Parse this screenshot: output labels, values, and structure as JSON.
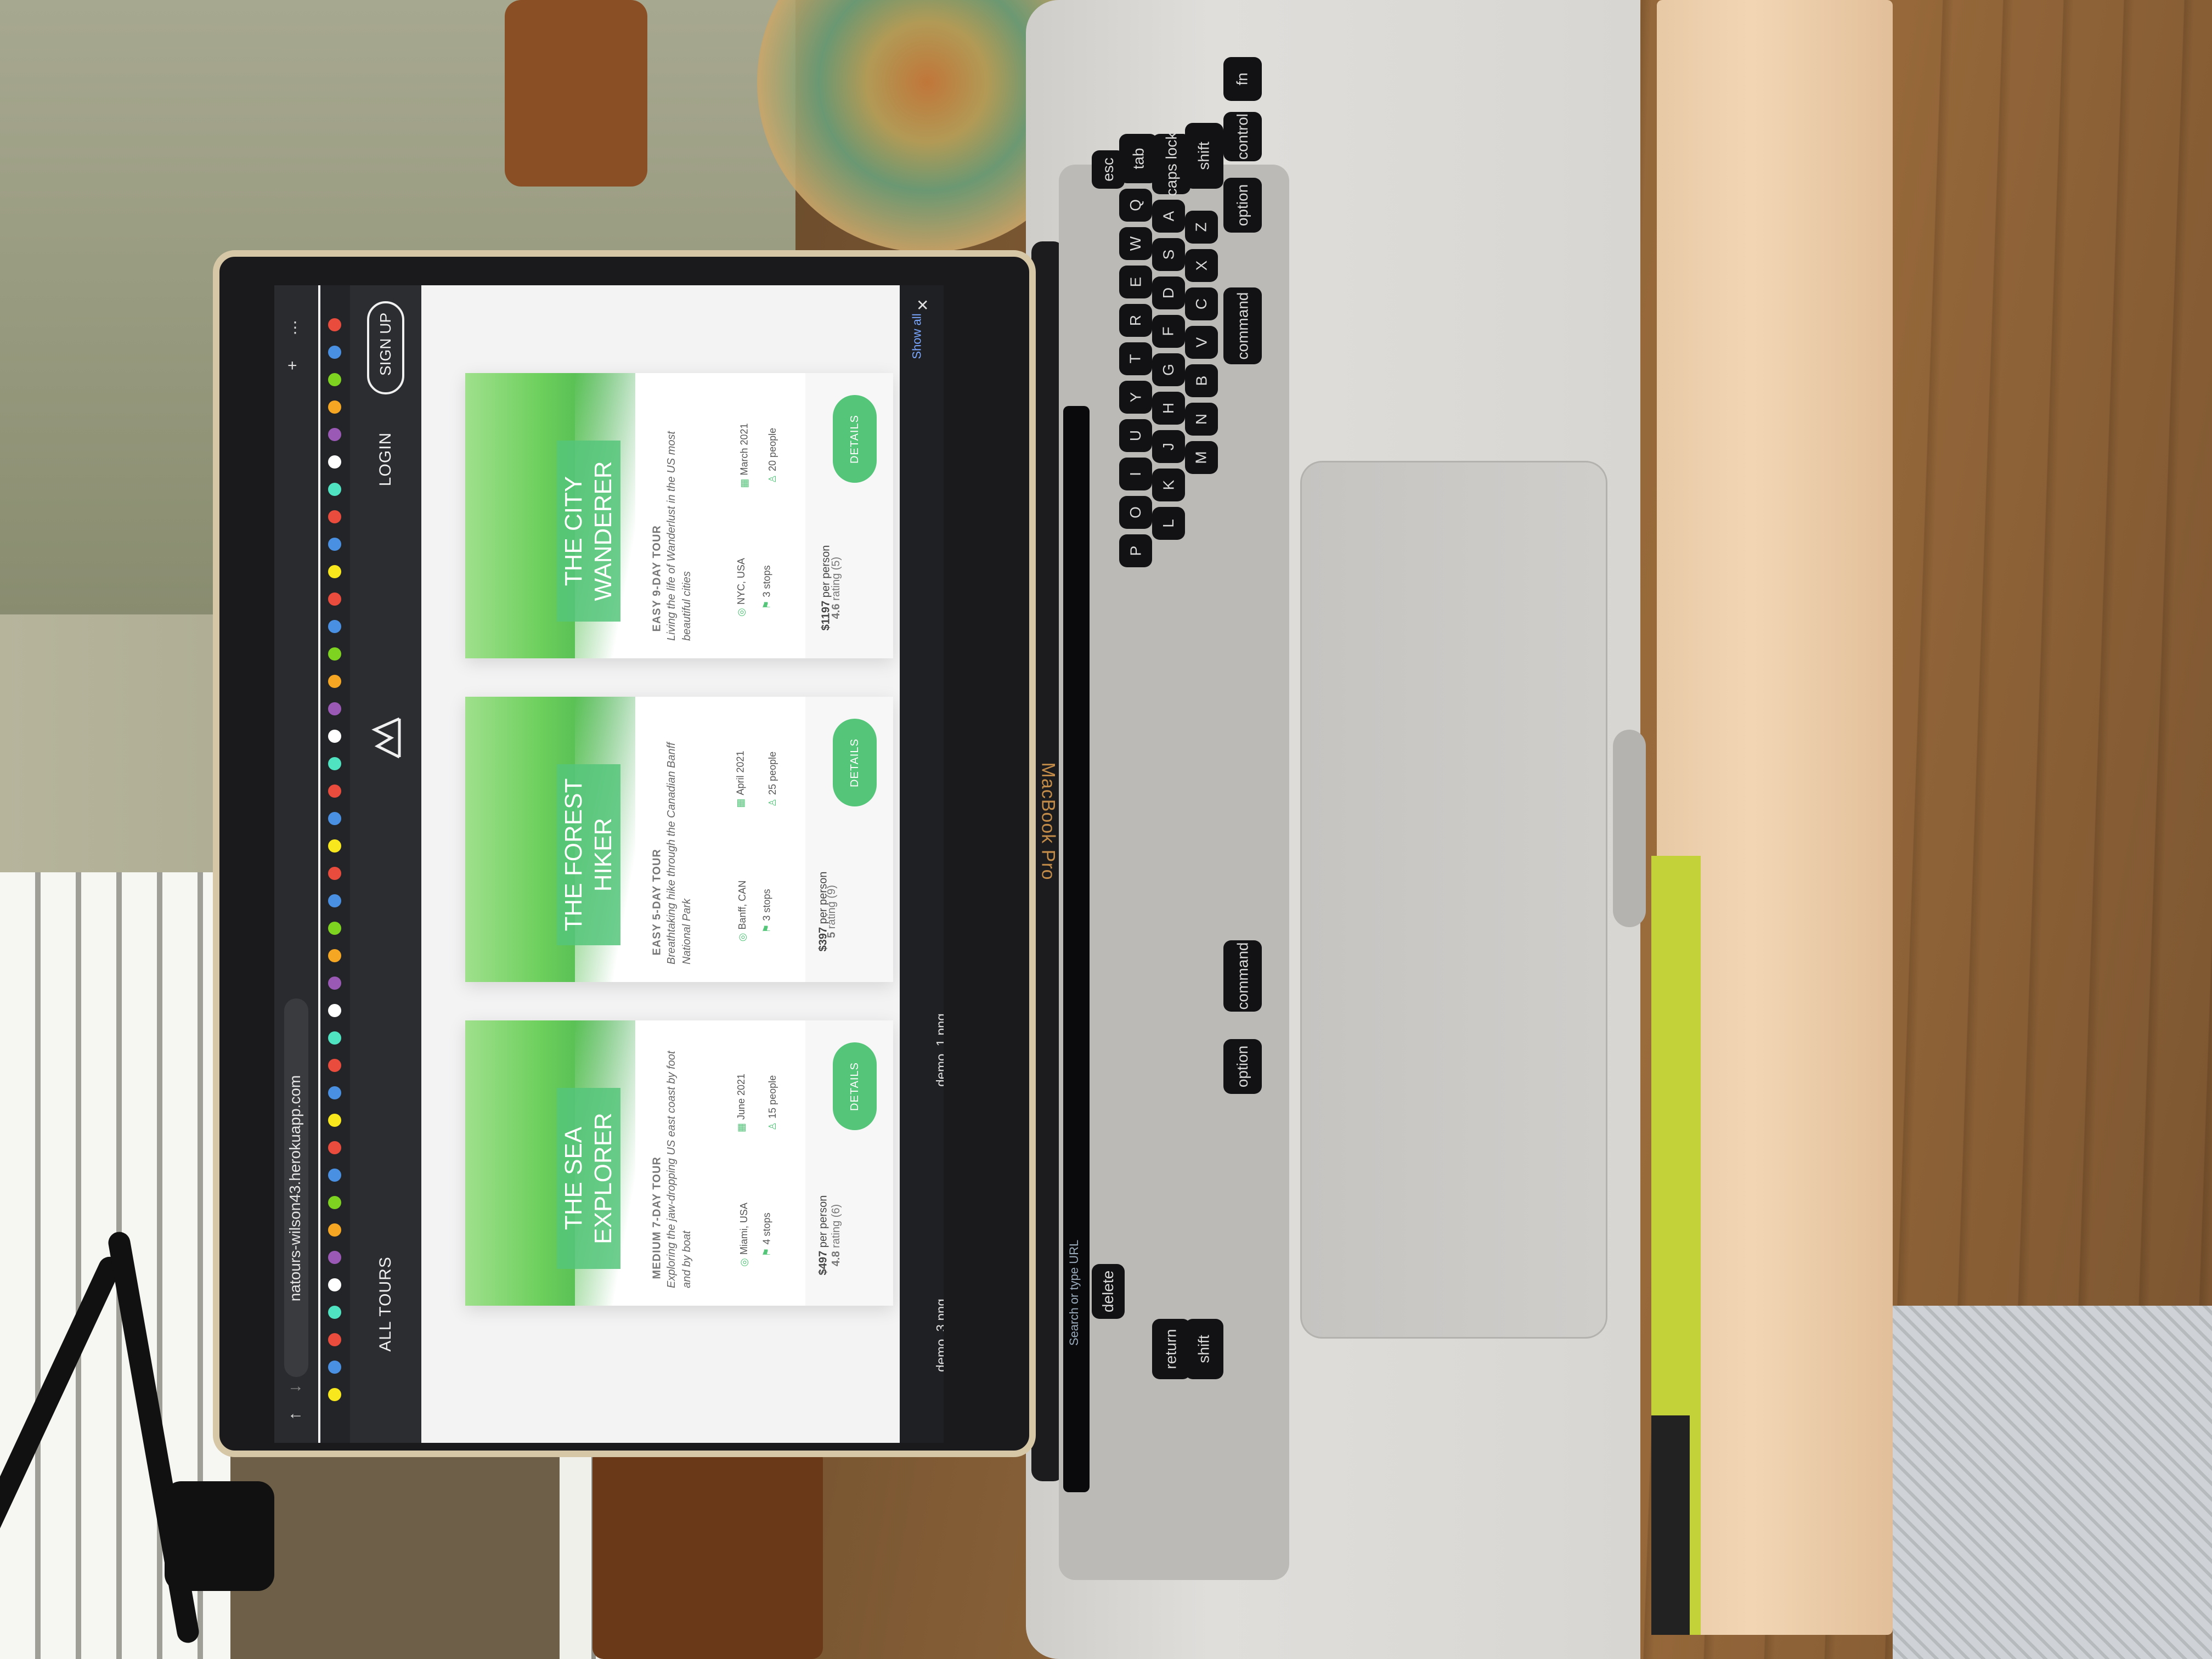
{
  "browser": {
    "url": "natours-wilson43.herokuapp.com"
  },
  "site": {
    "nav_all_tours": "ALL TOURS",
    "nav_login": "LOGIN",
    "nav_signup": "SIGN UP",
    "logo_icon": "mountain-logo-icon"
  },
  "tours": [
    {
      "name": "THE SEA EXPLORER",
      "subheading": "MEDIUM 7-DAY TOUR",
      "summary": "Exploring the jaw-dropping US east coast by foot and by boat",
      "location": "Miami, USA",
      "date": "June 2021",
      "stops": "4 stops",
      "people": "15 people",
      "price": "$497",
      "price_unit": "per person",
      "rating": "4.8",
      "rating_label": "rating (6)",
      "button": "DETAILS"
    },
    {
      "name": "THE FOREST HIKER",
      "subheading": "EASY 5-DAY TOUR",
      "summary": "Breathtaking hike through the Canadian Banff National Park",
      "location": "Banff, CAN",
      "date": "April 2021",
      "stops": "3 stops",
      "people": "25 people",
      "price": "$397",
      "price_unit": "per person",
      "rating": "5",
      "rating_label": "rating (9)",
      "button": "DETAILS"
    },
    {
      "name": "THE CITY WANDERER",
      "subheading": "EASY 9-DAY TOUR",
      "summary": "Living the life of Wanderlust in the US most beautiful cities",
      "location": "NYC, USA",
      "date": "March 2021",
      "stops": "3 stops",
      "people": "20 people",
      "price": "$1197",
      "price_unit": "per person",
      "rating": "4.6",
      "rating_label": "rating (5)",
      "button": "DETAILS"
    }
  ],
  "downloads": {
    "files": [
      "demo_3.png",
      "demo_1.png"
    ],
    "show_all": "Show all",
    "close": "✕"
  },
  "laptop": {
    "brand": "MacBook Pro",
    "touchbar_text": "Search or type URL"
  },
  "keyboard": {
    "keys": [
      "esc",
      "tab",
      "caps lock",
      "shift",
      "fn",
      "control",
      "option",
      "command",
      "Q",
      "W",
      "E",
      "R",
      "T",
      "Y",
      "U",
      "I",
      "O",
      "P",
      "A",
      "S",
      "D",
      "F",
      "G",
      "H",
      "J",
      "K",
      "L",
      "Z",
      "X",
      "C",
      "V",
      "B",
      "N",
      "M",
      "delete",
      "return",
      "shift",
      "command",
      "option"
    ]
  }
}
